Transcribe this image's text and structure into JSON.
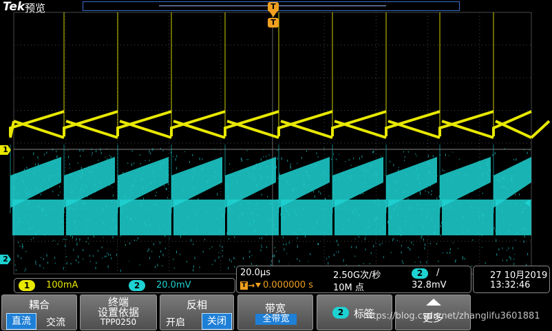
{
  "header": {
    "brand": "Tek",
    "mode": "预览"
  },
  "trigger_marker": "T",
  "channel_markers": {
    "ch1": "1",
    "ch2": "2"
  },
  "colors": {
    "ch1": "#e8e800",
    "ch2": "#1ed2d2",
    "trigger": "#f0a020",
    "grid": "#4a4a4a",
    "selected": "#1e7fd6"
  },
  "channel_readout": {
    "ch1": {
      "number": "1",
      "scale": "100mA"
    },
    "ch2": {
      "number": "2",
      "scale": "20.0mV"
    }
  },
  "timebase": {
    "scale": "20.0μs",
    "sample_rate": "2.50G次/秒",
    "position": "0.000000 s",
    "record_length": "10M 点"
  },
  "trigger_readout": {
    "source": "2",
    "slope": "/",
    "level": "32.8mV"
  },
  "datetime": {
    "date": "27 10月2019",
    "time": "13:32:46"
  },
  "menu": {
    "coupling": {
      "title": "耦合",
      "option_dc": "直流",
      "option_ac": "交流",
      "selected": "直流"
    },
    "termination": {
      "title_line1": "终端",
      "title_line2": "设置依据",
      "value": "TPP0250"
    },
    "invert": {
      "title": "反相",
      "option_on": "开启",
      "option_off": "关闭",
      "selected": "关闭"
    },
    "bandwidth": {
      "title": "带宽",
      "value": "全带宽"
    },
    "label": {
      "channel": "2",
      "title": "标签"
    },
    "more": {
      "title": "更多"
    }
  },
  "watermark": "https://blog.csdn.net/zhanglifu3601881"
}
